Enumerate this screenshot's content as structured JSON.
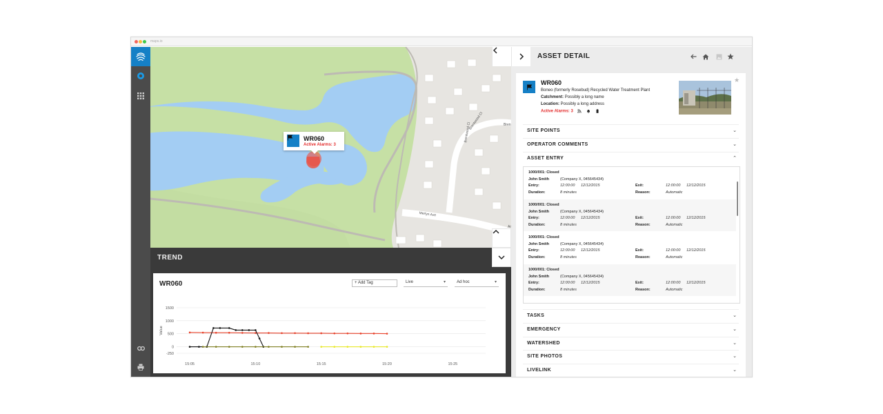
{
  "browser": {
    "url": "maps.io"
  },
  "map": {
    "popup": {
      "id": "WR060",
      "alarms": "Active Alarms: 3"
    },
    "streets": {
      "brentwood_1": "Brentwood Cl",
      "brentwood_2": "Brentwood Cl",
      "merlyn": "Merlyn Ave",
      "brent_edge": "Bren",
      "a_edge": "Ar"
    }
  },
  "trend": {
    "title": "TREND",
    "card_title": "WR060",
    "add_tag": "+ Add Tag",
    "mode": "Live",
    "range": "Ad hoc"
  },
  "chart_data": {
    "type": "line",
    "ylabel": "Value",
    "xlabel": "",
    "ylim": [
      -250,
      1500
    ],
    "yticks": [
      "1500",
      "1000",
      "500",
      "0",
      "-250"
    ],
    "xticks": [
      "15:05",
      "15:10",
      "15:15",
      "15:20",
      "15:25"
    ],
    "xlim": [
      15.04,
      15.275
    ],
    "grid": true,
    "series": [
      {
        "color": "#e8412a",
        "x": [
          15.05,
          15.06,
          15.07,
          15.08,
          15.09,
          15.1,
          15.11,
          15.12,
          15.13,
          15.14,
          15.15,
          15.16,
          15.17,
          15.18,
          15.19,
          15.2
        ],
        "values": [
          550,
          545,
          540,
          540,
          535,
          530,
          530,
          525,
          525,
          520,
          520,
          515,
          515,
          510,
          510,
          505
        ]
      },
      {
        "color": "#111111",
        "x": [
          15.05,
          15.057,
          15.063,
          15.068,
          15.073,
          15.08,
          15.085,
          15.09,
          15.095,
          15.1,
          15.103,
          15.106
        ],
        "values": [
          0,
          0,
          0,
          720,
          720,
          720,
          640,
          640,
          640,
          640,
          320,
          0
        ]
      },
      {
        "color": "#7f7f22",
        "x": [
          15.06,
          15.07,
          15.08,
          15.09,
          15.1,
          15.11,
          15.12,
          15.13,
          15.14
        ],
        "values": [
          0,
          0,
          0,
          0,
          0,
          0,
          0,
          0,
          0
        ]
      },
      {
        "color": "#e8e82a",
        "x": [
          15.15,
          15.16,
          15.17,
          15.18,
          15.19,
          15.2
        ],
        "values": [
          0,
          0,
          0,
          0,
          0,
          0
        ]
      }
    ]
  },
  "panel": {
    "title": "ASSET DETAIL",
    "asset": {
      "id": "WR060",
      "name": "Boneo (formerly Rosebud) Recycled Water Treatment Plant",
      "catchment_label": "Catchment:",
      "catchment": "Possibly a long name",
      "location_label": "Location:",
      "location": "Possibly a long address",
      "alarms": "Active Alarms: 3"
    },
    "sections_top": [
      "SITE POINTS",
      "OPERATOR COMMENTS",
      "ASSET ENTRY"
    ],
    "sections_bottom": [
      "TASKS",
      "EMERGENCY",
      "WATERSHED",
      "SITE PHOTOS",
      "LIVELINK"
    ],
    "entry_labels": {
      "entry": "Entry:",
      "exit": "Exit:",
      "duration": "Duration:",
      "reason": "Reason:"
    },
    "entries": [
      {
        "title": "1000/001: Closed",
        "name": "John Smith",
        "company": "(Company X, 045645434)",
        "entry_time": "12:00:00",
        "entry_date": "12/12/2015",
        "exit_time": "12:00:00",
        "exit_date": "12/12/2015",
        "duration": "8 minutes",
        "reason": "Automatic"
      },
      {
        "title": "1000/001: Closed",
        "name": "John Smith",
        "company": "(Company X, 045645434)",
        "entry_time": "12:00:00",
        "entry_date": "12/12/2015",
        "exit_time": "12:00:00",
        "exit_date": "12/12/2015",
        "duration": "8 minutes",
        "reason": "Automatic"
      },
      {
        "title": "1000/001: Closed",
        "name": "John Smith",
        "company": "(Company X, 045645434)",
        "entry_time": "12:00:00",
        "entry_date": "12/12/2015",
        "exit_time": "12:00:00",
        "exit_date": "12/12/2015",
        "duration": "8 minutes",
        "reason": "Automatic"
      },
      {
        "title": "1000/001: Closed",
        "name": "John Smith",
        "company": "(Company X, 045645434)",
        "entry_time": "12:00:00",
        "entry_date": "12/12/2015",
        "exit_time": "12:00:00",
        "exit_date": "12/12/2015",
        "duration": "8 minutes",
        "reason": "Automatic"
      }
    ]
  },
  "colors": {
    "accent": "#1580c6",
    "alarm": "#e32b2b",
    "rail": "#4b4b4b",
    "trend_bg": "#3a3a3a",
    "water": "#a3cdf3",
    "park": "#c6e0a5"
  }
}
